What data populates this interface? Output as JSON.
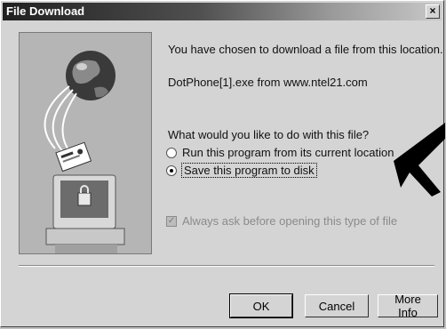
{
  "window": {
    "title": "File Download",
    "close_label": "×"
  },
  "message": {
    "intro": "You have chosen to download a file from this location.",
    "filename": "DotPhone[1].exe from www.ntel21.com",
    "question": "What would you like to do with this file?"
  },
  "options": {
    "run_label": "Run this program from its current location",
    "save_label": "Save this program to disk",
    "selected": "save"
  },
  "checkbox": {
    "label": "Always ask before opening this type of file",
    "checked": true,
    "disabled": true
  },
  "buttons": {
    "ok": "OK",
    "cancel": "Cancel",
    "more_info": "More Info"
  },
  "colors": {
    "title_dark": "#202020",
    "face": "#d4d4d4",
    "arrow": "#000000"
  }
}
